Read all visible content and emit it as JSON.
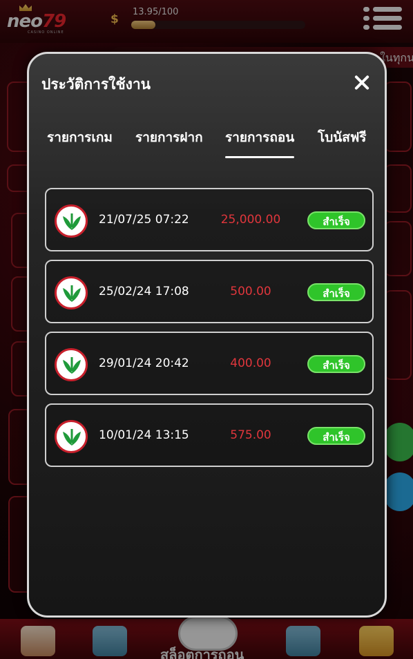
{
  "app": {
    "logo_main": "neo",
    "logo_num": "79",
    "logo_sub": "CASINO ONLINE"
  },
  "header": {
    "xp_text": "13.95/100",
    "xp_progress": 0.14,
    "ticker_text": "ในทุกน"
  },
  "modal": {
    "title": "ประวัติการใช้งาน",
    "tabs": [
      {
        "label": "รายการเกม",
        "active": false
      },
      {
        "label": "รายการฝาก",
        "active": false
      },
      {
        "label": "รายการถอน",
        "active": true
      },
      {
        "label": "โบนัสฟรี",
        "active": false
      }
    ],
    "rows": [
      {
        "datetime": "21/07/25 07:22",
        "amount": "25,000.00",
        "status": "สำเร็จ"
      },
      {
        "datetime": "25/02/24 17:08",
        "amount": "500.00",
        "status": "สำเร็จ"
      },
      {
        "datetime": "29/01/24 20:42",
        "amount": "400.00",
        "status": "สำเร็จ"
      },
      {
        "datetime": "10/01/24 13:15",
        "amount": "575.00",
        "status": "สำเร็จ"
      }
    ]
  },
  "colors": {
    "accent_red": "#e0363c",
    "success_green": "#2fc42a",
    "bank_green": "#1f9a3a"
  },
  "bottom_nav": {
    "center_label": "สล็อตการถอน"
  }
}
